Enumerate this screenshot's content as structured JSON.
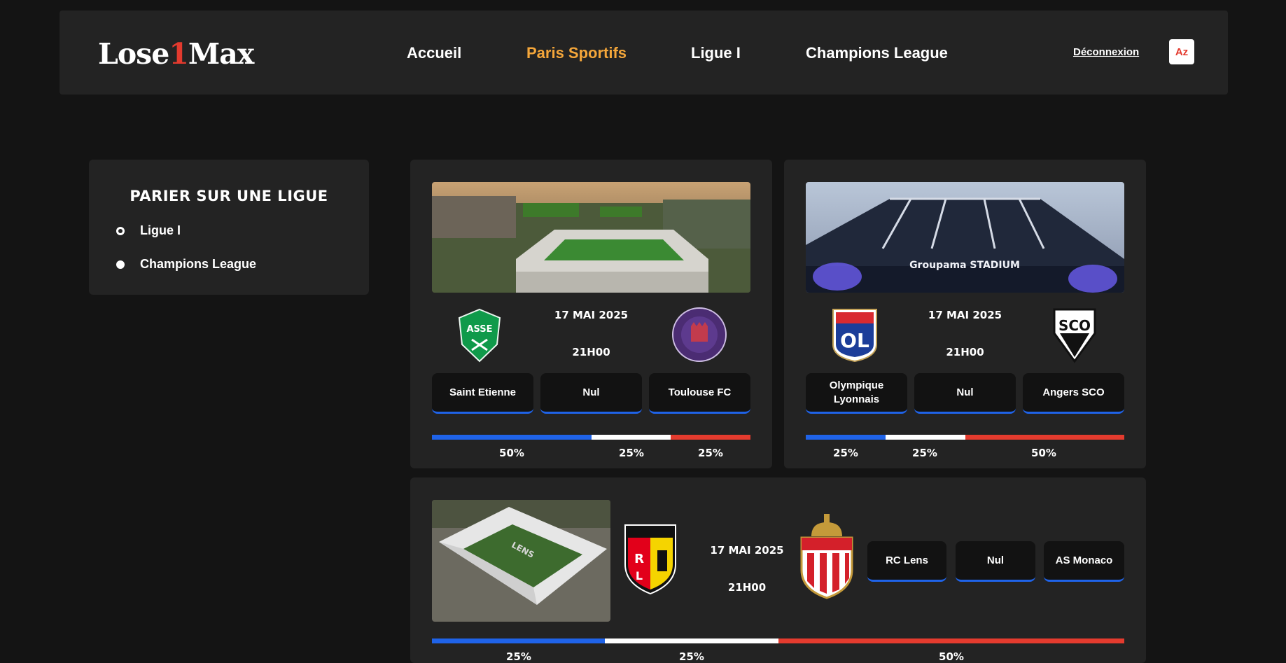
{
  "header": {
    "logo_prefix": "Lose",
    "logo_digit": "1",
    "logo_suffix": "Max",
    "nav": [
      "Accueil",
      "Paris Sportifs",
      "Ligue I",
      "Champions League"
    ],
    "active_nav": "Paris Sportifs",
    "logout": "Déconnexion",
    "avatar": "Az"
  },
  "sidebar": {
    "title": "Parier sur une ligue",
    "options": [
      "Ligue I",
      "Champions League"
    ],
    "selected": "Ligue I"
  },
  "matches": [
    {
      "date": "17 Mai 2025",
      "time": "21h00",
      "home": "Saint Etienne",
      "draw": "Nul",
      "away": "Toulouse FC",
      "home_crest": "asse-crest-icon",
      "away_crest": "toulouse-crest-icon",
      "pct": [
        "50%",
        "25%",
        "25%"
      ],
      "shares": [
        0.5,
        0.25,
        0.25
      ]
    },
    {
      "date": "17 Mai 2025",
      "time": "21h00",
      "home": "Olympique Lyonnais",
      "draw": "Nul",
      "away": "Angers SCO",
      "home_crest": "ol-crest-icon",
      "away_crest": "sco-crest-icon",
      "pct": [
        "25%",
        "25%",
        "50%"
      ],
      "shares": [
        0.25,
        0.25,
        0.5
      ],
      "stadium_sign": "Groupama STADIUM"
    },
    {
      "date": "17 Mai 2025",
      "time": "21h00",
      "home": "RC Lens",
      "draw": "Nul",
      "away": "AS Monaco",
      "home_crest": "rcl-crest-icon",
      "away_crest": "monaco-crest-icon",
      "pct": [
        "25%",
        "25%",
        "50%"
      ],
      "shares": [
        0.25,
        0.25,
        0.5
      ],
      "stadium_sign": "LENS"
    }
  ],
  "colors": {
    "home": "#1f63e8",
    "draw": "#ffffff",
    "away": "#e43b2e",
    "accent": "#f4a63a"
  }
}
